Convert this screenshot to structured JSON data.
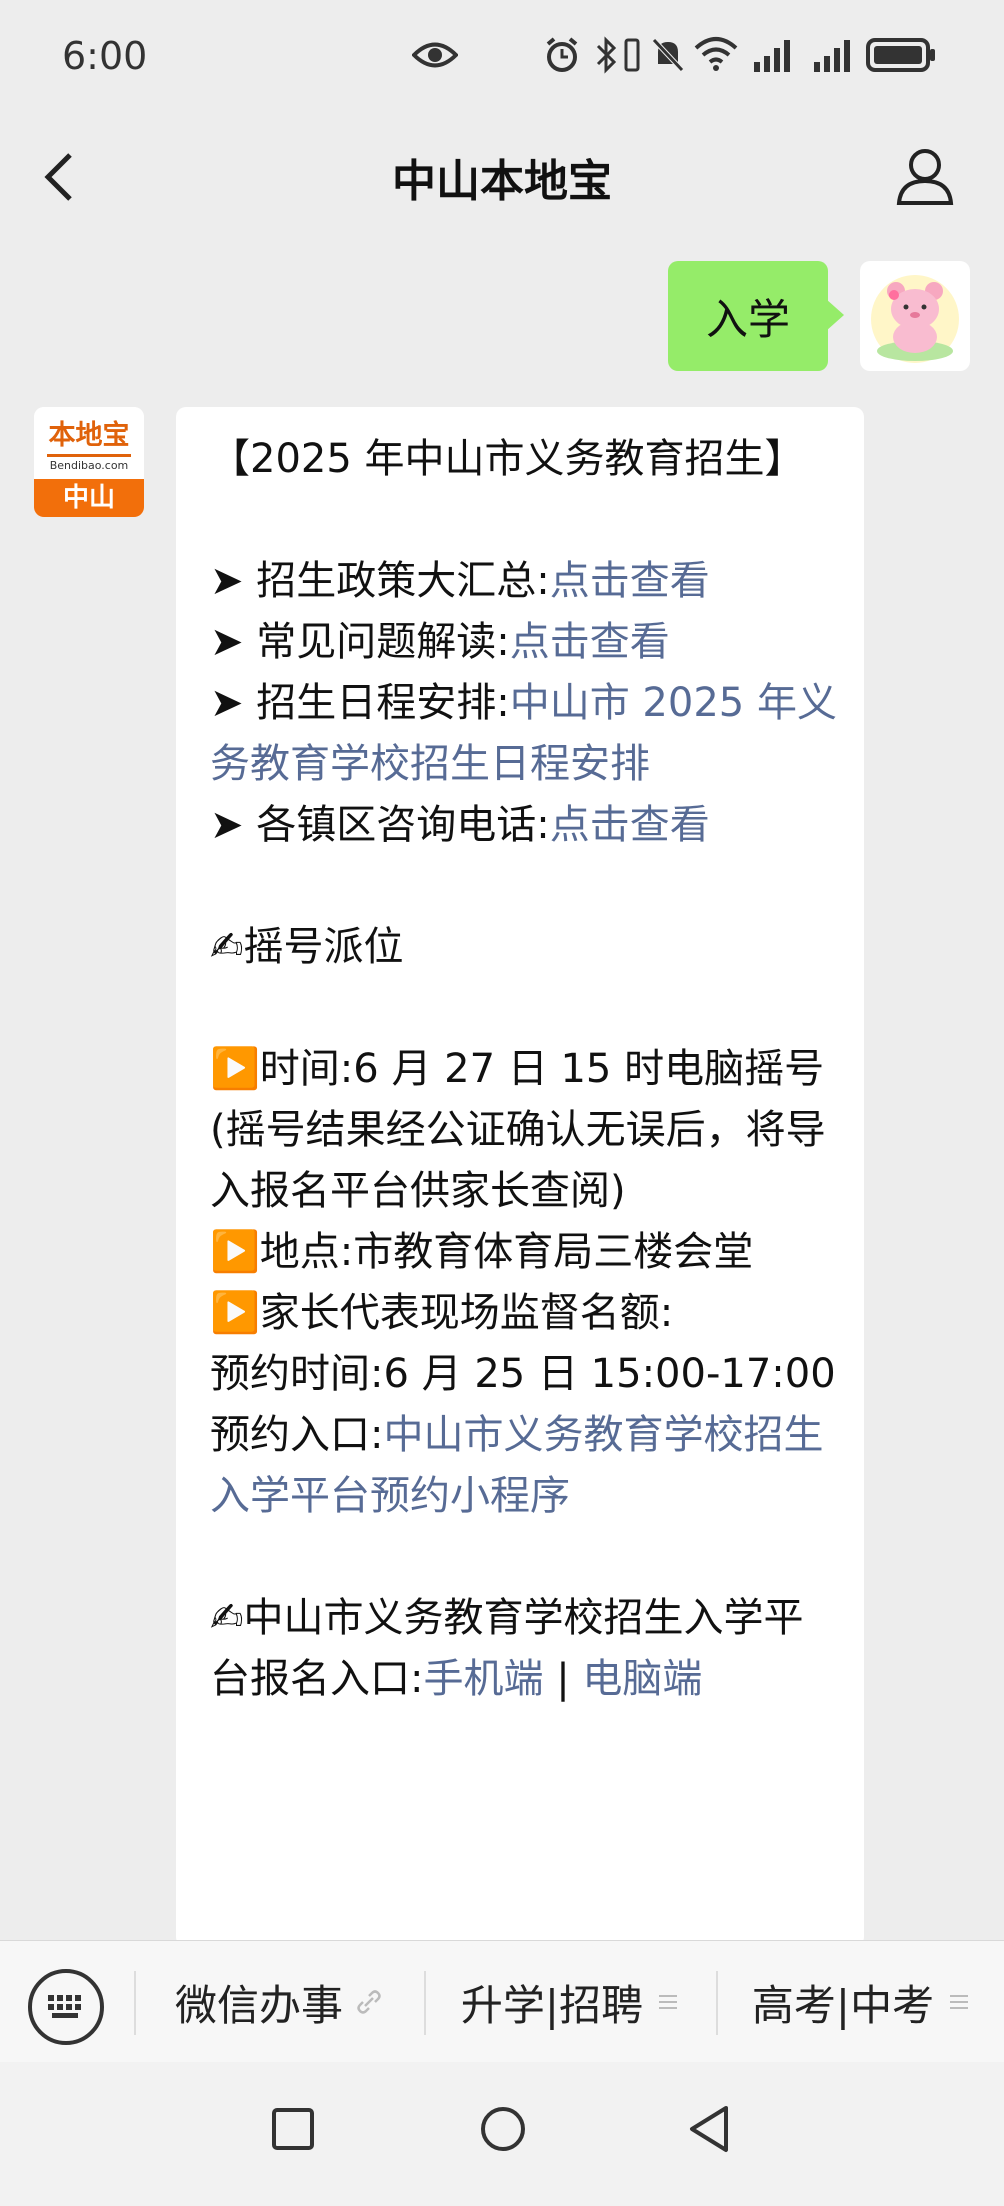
{
  "status_bar": {
    "time": "6:00",
    "icons": [
      "eye-icon",
      "alarm-icon",
      "bluetooth-icon",
      "vibrate-icon",
      "mute-icon",
      "wifi-icon",
      "signal-icon",
      "signal-icon",
      "battery-icon"
    ]
  },
  "header": {
    "title": "中山本地宝"
  },
  "chat": {
    "my_message": "入学",
    "bot_avatar": {
      "top": "本地宝",
      "domain": "Bendibao.com",
      "city": "中山"
    },
    "bot_message": {
      "heading": "【2025 年中山市义务教育招生】",
      "items": [
        {
          "bullet": "➤",
          "text": "招生政策大汇总:",
          "link": "点击查看"
        },
        {
          "bullet": "➤",
          "text": "常见问题解读:",
          "link": "点击查看"
        },
        {
          "bullet": "➤",
          "text": "招生日程安排:",
          "link": "中山市 2025 年义务教育学校招生日程安排"
        },
        {
          "bullet": "➤",
          "text": "各镇区咨询电话:",
          "link": "点击查看"
        }
      ],
      "section1_title": "✍摇号派位",
      "time_line": "▶️时间:6 月 27 日 15 时电脑摇号",
      "time_note": "(摇号结果经公证确认无误后，将导入报名平台供家长查阅)",
      "place_line": "▶️地点:市教育体育局三楼会堂",
      "quota_line": "▶️家长代表现场监督名额:",
      "appoint_time": "预约时间:6 月 25 日 15:00-17:00",
      "appoint_entry_label": "预约入口:",
      "appoint_entry_link": "中山市义务教育学校招生入学平台预约小程序",
      "section2_title": "✍中山市义务教育学校招生入学平台报名入口:",
      "entry_mobile": "手机端",
      "entry_sep": " | ",
      "entry_pc": "电脑端"
    }
  },
  "menu": {
    "items": [
      {
        "label": "微信办事",
        "suffix_icon": "link-icon"
      },
      {
        "label": "升学|招聘",
        "suffix_icon": "menu-lines-icon"
      },
      {
        "label": "高考|中考",
        "suffix_icon": "menu-lines-icon"
      }
    ]
  },
  "nav": [
    "recent-apps-button",
    "home-button",
    "back-button"
  ],
  "colors": {
    "bubble_me": "#95ec69",
    "link": "#576b95",
    "bot_brand": "#f26f0b"
  }
}
